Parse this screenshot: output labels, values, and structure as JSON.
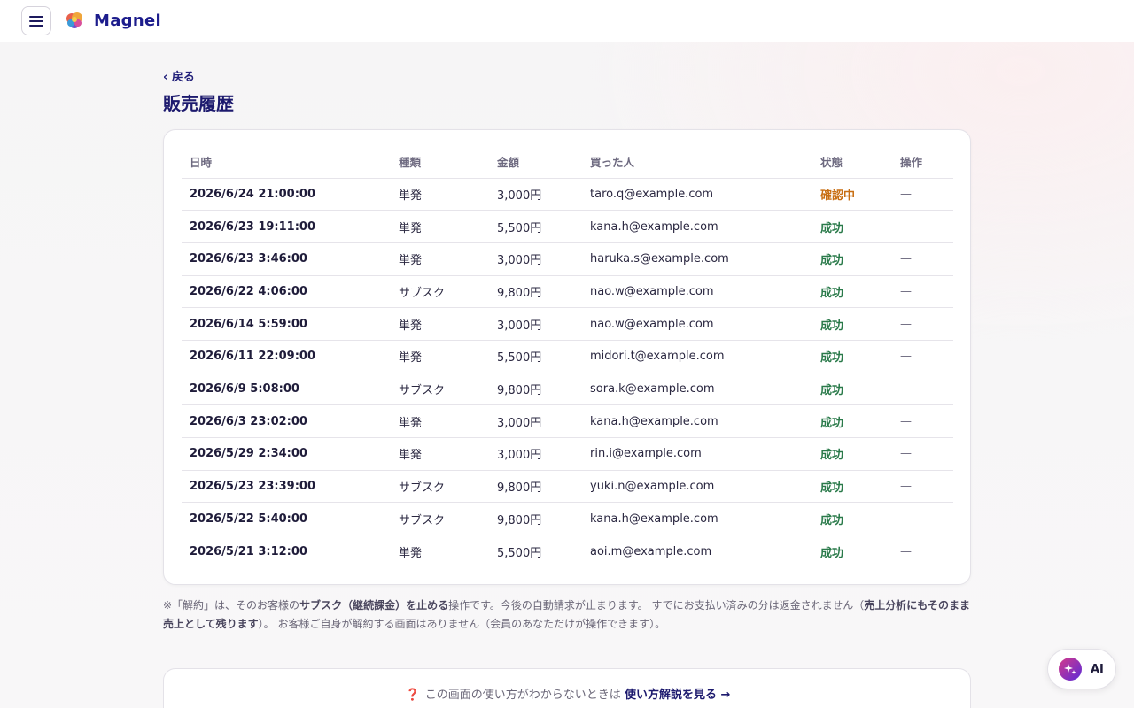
{
  "header": {
    "brand": "Magnel",
    "menu_icon": "hamburger-menu-icon",
    "logo_icon": "brain-logo-icon"
  },
  "nav": {
    "back_label": "‹ 戻る"
  },
  "page": {
    "title": "販売履歴"
  },
  "table": {
    "columns": [
      "日時",
      "種類",
      "金額",
      "買った人",
      "状態",
      "操作"
    ],
    "rows": [
      {
        "datetime": "2026/6/24 21:00:00",
        "type": "単発",
        "amount": "3,000円",
        "buyer": "taro.q@example.com",
        "status": "確認中",
        "action": "—"
      },
      {
        "datetime": "2026/6/23 19:11:00",
        "type": "単発",
        "amount": "5,500円",
        "buyer": "kana.h@example.com",
        "status": "成功",
        "action": "—"
      },
      {
        "datetime": "2026/6/23 3:46:00",
        "type": "単発",
        "amount": "3,000円",
        "buyer": "haruka.s@example.com",
        "status": "成功",
        "action": "—"
      },
      {
        "datetime": "2026/6/22 4:06:00",
        "type": "サブスク",
        "amount": "9,800円",
        "buyer": "nao.w@example.com",
        "status": "成功",
        "action": "—"
      },
      {
        "datetime": "2026/6/14 5:59:00",
        "type": "単発",
        "amount": "3,000円",
        "buyer": "nao.w@example.com",
        "status": "成功",
        "action": "—"
      },
      {
        "datetime": "2026/6/11 22:09:00",
        "type": "単発",
        "amount": "5,500円",
        "buyer": "midori.t@example.com",
        "status": "成功",
        "action": "—"
      },
      {
        "datetime": "2026/6/9 5:08:00",
        "type": "サブスク",
        "amount": "9,800円",
        "buyer": "sora.k@example.com",
        "status": "成功",
        "action": "—"
      },
      {
        "datetime": "2026/6/3 23:02:00",
        "type": "単発",
        "amount": "3,000円",
        "buyer": "kana.h@example.com",
        "status": "成功",
        "action": "—"
      },
      {
        "datetime": "2026/5/29 2:34:00",
        "type": "単発",
        "amount": "3,000円",
        "buyer": "rin.i@example.com",
        "status": "成功",
        "action": "—"
      },
      {
        "datetime": "2026/5/23 23:39:00",
        "type": "サブスク",
        "amount": "9,800円",
        "buyer": "yuki.n@example.com",
        "status": "成功",
        "action": "—"
      },
      {
        "datetime": "2026/5/22 5:40:00",
        "type": "サブスク",
        "amount": "9,800円",
        "buyer": "kana.h@example.com",
        "status": "成功",
        "action": "—"
      },
      {
        "datetime": "2026/5/21 3:12:00",
        "type": "単発",
        "amount": "5,500円",
        "buyer": "aoi.m@example.com",
        "status": "成功",
        "action": "—"
      }
    ]
  },
  "note": {
    "part1": "※「解約」は、そのお客様の",
    "bold1": "サブスク（継続課金）を止める",
    "part2": "操作です。今後の自動請求が止まります。 すでにお支払い済みの分は返金されません（",
    "bold2": "売上分析にもそのまま売上として残ります",
    "part3": "）。 お客様ご自身が解約する画面はありません（会員のあなただけが操作できます）。"
  },
  "help": {
    "icon": "question-mark-icon",
    "question_mark": "❓",
    "text": "この画面の使い方がわからないときは",
    "link_label": "使い方解説を見る →"
  },
  "ai_button": {
    "label": "AI",
    "icon": "sparkle-icon"
  },
  "colors": {
    "brand": "#1c1c8c",
    "status_ok": "#2a7a4a",
    "status_pending": "#c86e12"
  }
}
